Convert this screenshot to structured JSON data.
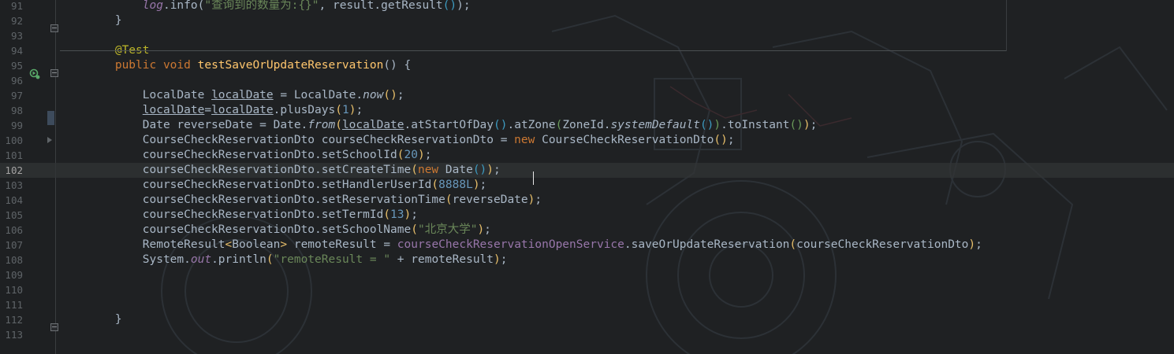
{
  "editor": {
    "caret_line": "102",
    "lines": [
      {
        "n": "91",
        "tokens": [
          [
            "    "
          ],
          [
            "log",
            "field it"
          ],
          [
            ".info("
          ],
          [
            "\"查询到的数量为:{}\"",
            "str"
          ],
          [
            ", result.getResult"
          ],
          [
            "()",
            "brk2"
          ],
          [
            ");"
          ]
        ]
      },
      {
        "n": "92",
        "tokens": [
          [
            "}"
          ]
        ]
      },
      {
        "n": "93",
        "tokens": []
      },
      {
        "n": "94",
        "tokens": [
          [
            "@Test",
            "ann"
          ]
        ]
      },
      {
        "n": "95",
        "tokens": [
          [
            "public ",
            "kw"
          ],
          [
            "void ",
            "kw"
          ],
          [
            "testSaveOrUpdateReservation",
            "fn"
          ],
          [
            "() {"
          ]
        ]
      },
      {
        "n": "96",
        "tokens": []
      },
      {
        "n": "97",
        "tokens": [
          [
            "    LocalDate "
          ],
          [
            "localDate",
            "ul"
          ],
          [
            " = LocalDate."
          ],
          [
            "now",
            "it"
          ],
          [
            "()",
            "brk"
          ],
          [
            ";"
          ]
        ]
      },
      {
        "n": "98",
        "tokens": [
          [
            "    "
          ],
          [
            "localDate",
            "ul"
          ],
          [
            "="
          ],
          [
            "localDate",
            "ul"
          ],
          [
            ".plusDays"
          ],
          [
            "(",
            "brk"
          ],
          [
            "1",
            "num"
          ],
          [
            ")",
            "brk"
          ],
          [
            ";"
          ]
        ]
      },
      {
        "n": "99",
        "tokens": [
          [
            "    Date reverseDate = Date."
          ],
          [
            "from",
            "it"
          ],
          [
            "(",
            "brk"
          ],
          [
            "localDate",
            "ul"
          ],
          [
            ".atStartOfDay"
          ],
          [
            "()",
            "brk2"
          ],
          [
            ".atZone"
          ],
          [
            "(",
            "brk3"
          ],
          [
            "ZoneId."
          ],
          [
            "systemDefault",
            "it"
          ],
          [
            "()",
            "brk2"
          ],
          [
            ")",
            "brk3"
          ],
          [
            ".toInstant"
          ],
          [
            "()",
            "brk3"
          ],
          [
            ")",
            "brk"
          ],
          [
            ";"
          ]
        ]
      },
      {
        "n": "100",
        "tokens": [
          [
            "    CourseCheckReservationDto courseCheckReservationDto = "
          ],
          [
            "new ",
            "kw"
          ],
          [
            "CourseCheckReservationDto"
          ],
          [
            "()",
            "brk"
          ],
          [
            ";"
          ]
        ]
      },
      {
        "n": "101",
        "tokens": [
          [
            "    courseCheckReservationDto.setSchoolId"
          ],
          [
            "(",
            "brk"
          ],
          [
            "20",
            "num"
          ],
          [
            ")",
            "brk"
          ],
          [
            ";"
          ]
        ]
      },
      {
        "n": "102",
        "tokens": [
          [
            "    courseCheckReservationDto.setCreateTime"
          ],
          [
            "(",
            "brk"
          ],
          [
            "new ",
            "kw"
          ],
          [
            "Date"
          ],
          [
            "()",
            "brk2"
          ],
          [
            ")",
            "brk"
          ],
          [
            ";"
          ]
        ]
      },
      {
        "n": "103",
        "tokens": [
          [
            "    courseCheckReservationDto.setHandlerUserId"
          ],
          [
            "(",
            "brk"
          ],
          [
            "8888L",
            "num"
          ],
          [
            ")",
            "brk"
          ],
          [
            ";"
          ]
        ]
      },
      {
        "n": "104",
        "tokens": [
          [
            "    courseCheckReservationDto.setReservationTime"
          ],
          [
            "(",
            "brk"
          ],
          [
            "reverseDate"
          ],
          [
            ")",
            "brk"
          ],
          [
            ";"
          ]
        ]
      },
      {
        "n": "105",
        "tokens": [
          [
            "    courseCheckReservationDto.setTermId"
          ],
          [
            "(",
            "brk"
          ],
          [
            "13",
            "num"
          ],
          [
            ")",
            "brk"
          ],
          [
            ";"
          ]
        ]
      },
      {
        "n": "106",
        "tokens": [
          [
            "    courseCheckReservationDto.setSchoolName"
          ],
          [
            "(",
            "brk"
          ],
          [
            "\"北京大学\"",
            "str"
          ],
          [
            ")",
            "brk"
          ],
          [
            ";"
          ]
        ]
      },
      {
        "n": "107",
        "tokens": [
          [
            "    RemoteResult"
          ],
          [
            "<",
            "brk"
          ],
          [
            "Boolean"
          ],
          [
            ">",
            "brk"
          ],
          [
            " remoteResult = "
          ],
          [
            "courseCheckReservationOpenService",
            "field"
          ],
          [
            ".saveOrUpdateReservation"
          ],
          [
            "(",
            "brk"
          ],
          [
            "courseCheckReservationDto"
          ],
          [
            ")",
            "brk"
          ],
          [
            ";"
          ]
        ]
      },
      {
        "n": "108",
        "tokens": [
          [
            "    System."
          ],
          [
            "out",
            "field it"
          ],
          [
            ".println"
          ],
          [
            "(",
            "brk"
          ],
          [
            "\"remoteResult = \" ",
            "str"
          ],
          [
            "+ remoteResult"
          ],
          [
            ")",
            "brk"
          ],
          [
            ";"
          ]
        ]
      },
      {
        "n": "109",
        "tokens": []
      },
      {
        "n": "110",
        "tokens": []
      },
      {
        "n": "111",
        "tokens": []
      },
      {
        "n": "112",
        "tokens": [
          [
            "}"
          ]
        ]
      },
      {
        "n": "113",
        "tokens": []
      }
    ]
  },
  "colors": {
    "background": "#1f2123",
    "default_text": "#a9b7c6",
    "keyword": "#cc7832",
    "string": "#6a8759",
    "number": "#6897bb",
    "annotation": "#bbb529",
    "method_decl": "#ffc66d",
    "field": "#9876aa"
  },
  "icons": [
    "run-test-gutter-icon",
    "fold-icon",
    "bookmark-icon",
    "breakpoint-arrow-icon"
  ]
}
